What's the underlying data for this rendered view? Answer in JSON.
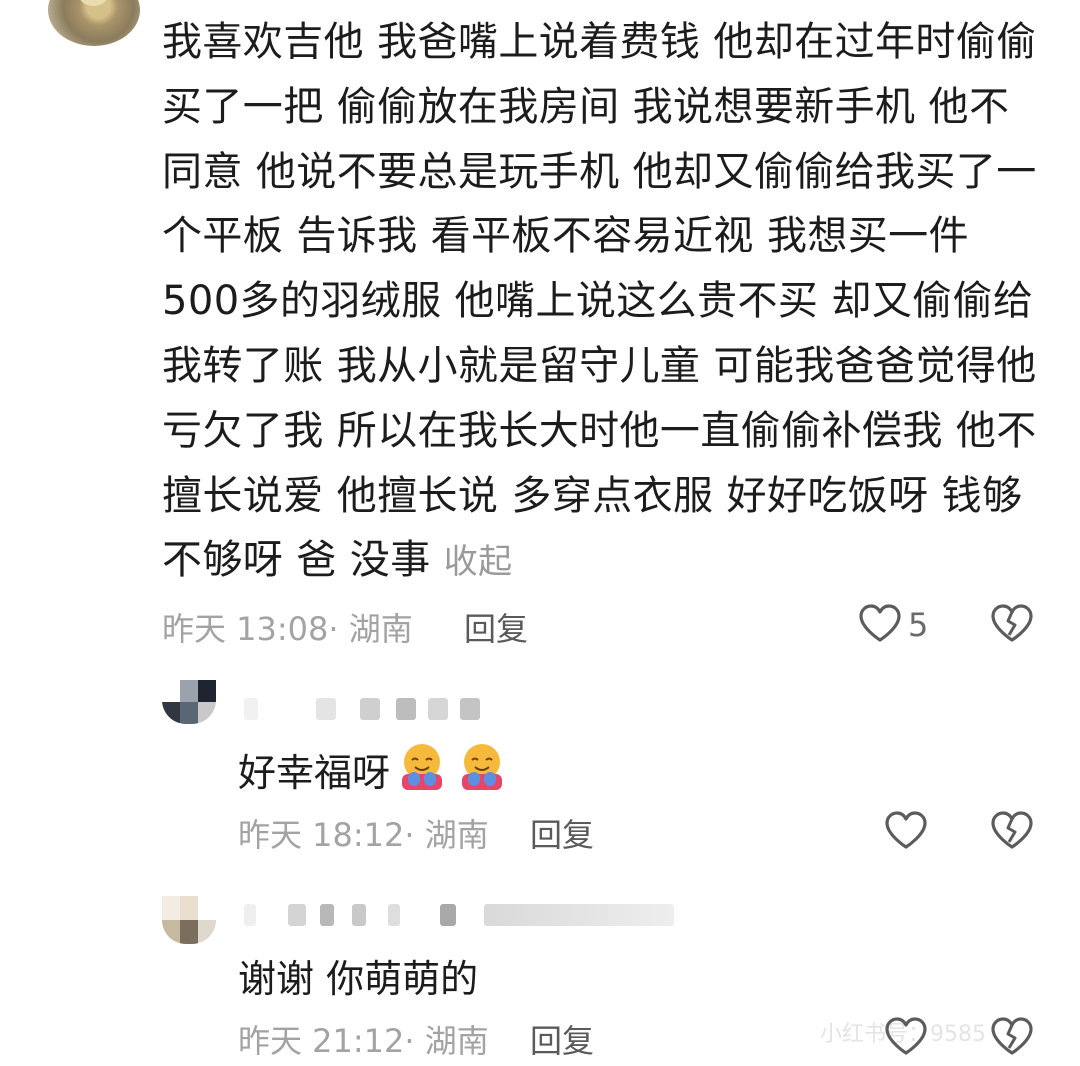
{
  "comment": {
    "text": "我喜欢吉他 我爸嘴上说着费钱 他却在过年时偷偷买了一把 偷偷放在我房间 我说想要新手机 他不同意 他说不要总是玩手机 他却又偷偷给我买了一个平板 告诉我 看平板不容易近视 我想买一件500多的羽绒服 他嘴上说这么贵不买 却又偷偷给我转了账 我从小就是留守儿童 可能我爸爸觉得他亏欠了我 所以在我长大时他一直偷偷补偿我 他不擅长说爱 他擅长说 多穿点衣服 好好吃饭呀 钱够不够呀 爸 没事",
    "collapse_label": "收起",
    "time": "昨天 13:08",
    "location": "· 湖南",
    "reply_label": "回复",
    "like_count": "5"
  },
  "replies": [
    {
      "text": "好幸福呀",
      "emoji": [
        "hugging-face-emoji",
        "hugging-face-emoji"
      ],
      "time": "昨天 18:12",
      "location": "· 湖南",
      "reply_label": "回复"
    },
    {
      "text": "谢谢 你萌萌的",
      "time": "昨天 21:12",
      "location": "· 湖南",
      "reply_label": "回复"
    }
  ],
  "watermark": "小红书号：9585",
  "colors": {
    "text": "#1c1c1c",
    "meta": "#a3a3a3",
    "icon": "#5c5c5c"
  },
  "icons": [
    "heart-icon",
    "broken-heart-icon"
  ]
}
